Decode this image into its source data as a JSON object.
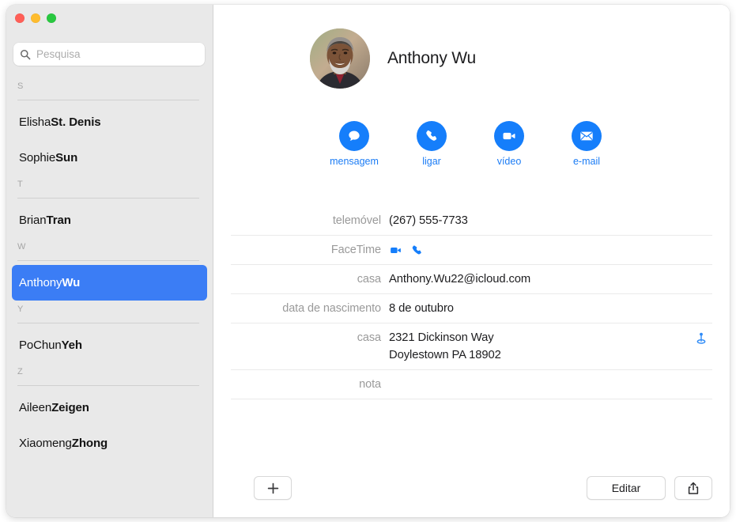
{
  "window": {
    "traffic_lights": [
      {
        "name": "close",
        "color": "#ff5f57"
      },
      {
        "name": "minimize",
        "color": "#febc2e"
      },
      {
        "name": "zoom",
        "color": "#29c840"
      }
    ]
  },
  "sidebar": {
    "search": {
      "placeholder": "Pesquisa",
      "value": "",
      "icon": "search-icon"
    },
    "sections": [
      {
        "letter": "S",
        "contacts": [
          {
            "first": "Elisha ",
            "last": "St. Denis",
            "selected": false
          },
          {
            "first": "Sophie ",
            "last": "Sun",
            "selected": false
          }
        ]
      },
      {
        "letter": "T",
        "contacts": [
          {
            "first": "Brian ",
            "last": "Tran",
            "selected": false
          }
        ]
      },
      {
        "letter": "W",
        "contacts": [
          {
            "first": "Anthony ",
            "last": "Wu",
            "selected": true
          }
        ]
      },
      {
        "letter": "Y",
        "contacts": [
          {
            "first": "PoChun ",
            "last": "Yeh",
            "selected": false
          }
        ]
      },
      {
        "letter": "Z",
        "contacts": [
          {
            "first": "Aileen ",
            "last": "Zeigen",
            "selected": false
          },
          {
            "first": "Xiaomeng ",
            "last": "Zhong",
            "selected": false
          }
        ]
      }
    ],
    "selection_color": "#3b7df5",
    "background_color": "#e9e9e9"
  },
  "detail": {
    "name": "Anthony Wu",
    "avatar": "contact-photo",
    "accent_color": "#157efb",
    "actions": [
      {
        "label": "mensagem",
        "icon": "message-icon"
      },
      {
        "label": "ligar",
        "icon": "phone-icon"
      },
      {
        "label": "vídeo",
        "icon": "video-icon"
      },
      {
        "label": "e-mail",
        "icon": "mail-icon"
      }
    ],
    "fields": [
      {
        "label": "telemóvel",
        "value": "(267) 555-7733"
      },
      {
        "label": "FaceTime",
        "value": "",
        "icons": [
          "video-icon",
          "phone-icon"
        ]
      },
      {
        "label": "casa",
        "value": "Anthony.Wu22@icloud.com"
      },
      {
        "label": "data de nascimento",
        "value": "8 de outubro"
      },
      {
        "label": "casa",
        "value": "2321 Dickinson Way",
        "value2": "Doylestown PA 18902",
        "trailing_icon": "map-pin-icon"
      },
      {
        "label": "nota",
        "value": ""
      }
    ]
  },
  "bottom_bar": {
    "add_label": "+",
    "edit_label": "Editar",
    "share_icon": "share-icon"
  }
}
